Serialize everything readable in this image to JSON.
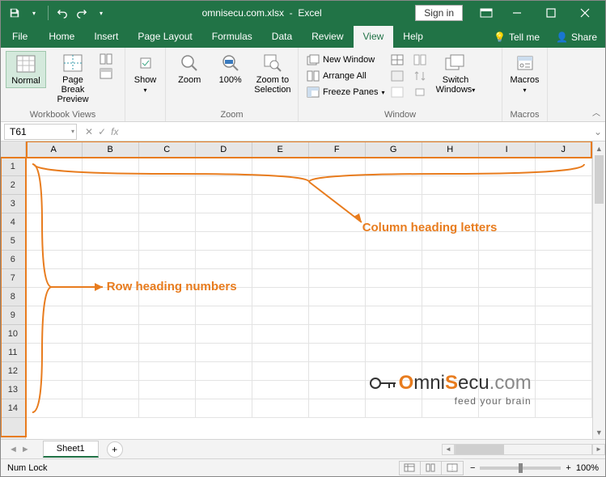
{
  "title": {
    "filename": "omnisecu.com.xlsx",
    "app": "Excel",
    "signin": "Sign in"
  },
  "menu": {
    "file": "File",
    "tabs": [
      "Home",
      "Insert",
      "Page Layout",
      "Formulas",
      "Data",
      "Review",
      "View",
      "Help"
    ],
    "active": "View",
    "tellme": "Tell me",
    "share": "Share"
  },
  "ribbon": {
    "workbook_views": {
      "label": "Workbook Views",
      "normal": "Normal",
      "page_break": "Page Break Preview"
    },
    "show": {
      "label": "Show",
      "btn": "Show"
    },
    "zoom": {
      "label": "Zoom",
      "zoom": "Zoom",
      "hundred": "100%",
      "selection": "Zoom to Selection"
    },
    "window": {
      "label": "Window",
      "new_window": "New Window",
      "arrange_all": "Arrange All",
      "freeze": "Freeze Panes",
      "switch": "Switch Windows"
    },
    "macros": {
      "label": "Macros",
      "btn": "Macros"
    }
  },
  "namebox": "T61",
  "formula_labels": {
    "cancel": "✕",
    "enter": "✓",
    "fx": "fx"
  },
  "columns": [
    "A",
    "B",
    "C",
    "D",
    "E",
    "F",
    "G",
    "H",
    "I",
    "J"
  ],
  "rows": [
    "1",
    "2",
    "3",
    "4",
    "5",
    "6",
    "7",
    "8",
    "9",
    "10",
    "11",
    "12",
    "13",
    "14"
  ],
  "sheet": {
    "name": "Sheet1"
  },
  "status": {
    "numlock": "Num Lock",
    "zoom_pct": "100%"
  },
  "annotations": {
    "columns": "Column heading letters",
    "rows": "Row heading numbers"
  },
  "logo": {
    "brand_pre": "O",
    "brand_mid1": "mni",
    "brand_mid2": "S",
    "brand_mid3": "ecu",
    "brand_suf": ".com",
    "tagline": "feed your brain"
  }
}
